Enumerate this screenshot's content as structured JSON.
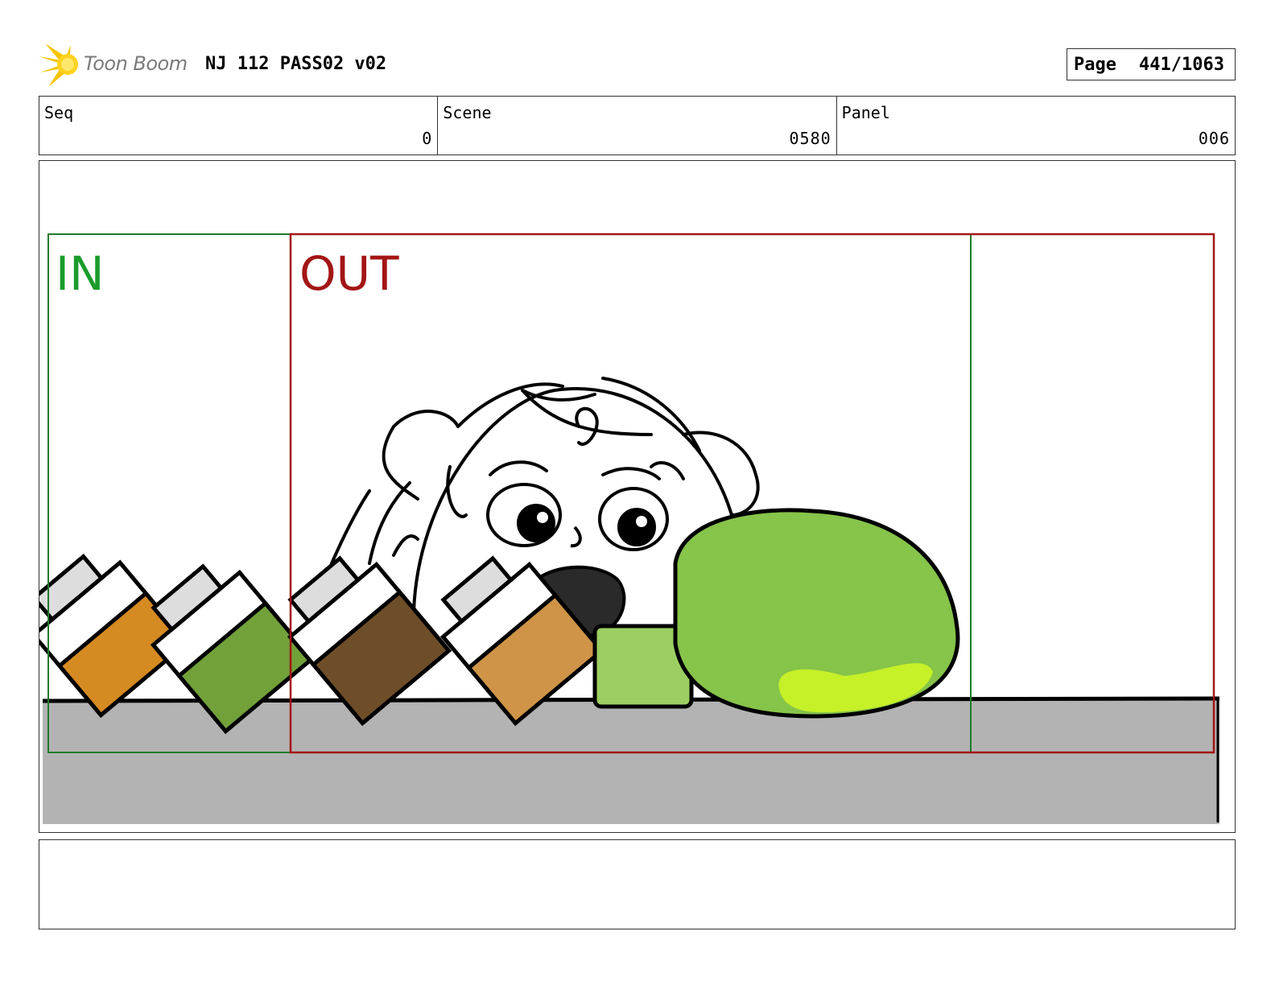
{
  "header": {
    "logo_text": "Toon Boom",
    "title": "NJ 112 PASS02 v02",
    "page_label": "Page",
    "page_value": "441/1063"
  },
  "info": {
    "seq_label": "Seq",
    "seq_value": "0",
    "scene_label": "Scene",
    "scene_value": "0580",
    "panel_label": "Panel",
    "panel_value": "006"
  },
  "drawing": {
    "in_label": "IN",
    "out_label": "OUT",
    "in_color": "#1a9c2a",
    "out_color": "#a31515",
    "ground_color": "#b3b3b3",
    "slime_color": "#86c44a",
    "slime_highlight": "#c6f028"
  },
  "notes": {
    "text": ""
  }
}
